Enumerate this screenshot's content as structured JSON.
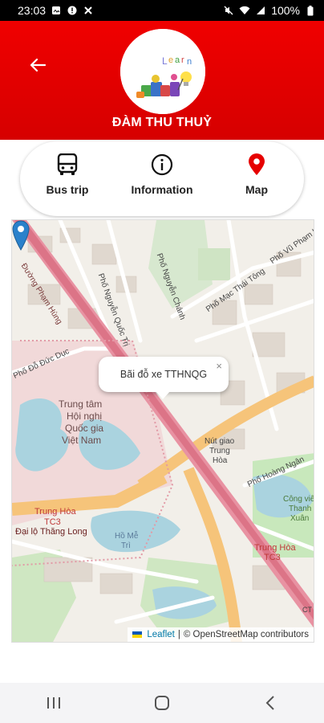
{
  "status_bar": {
    "time": "23:03",
    "battery": "100%",
    "left_icons": [
      "gallery-icon",
      "alert-icon",
      "tools-icon"
    ],
    "right_icons": [
      "mute-icon",
      "wifi-icon",
      "signal-icon",
      "battery-icon"
    ]
  },
  "header": {
    "school_name": "ĐÀM THU THUỶ",
    "background_color": "#e60000"
  },
  "tabs": [
    {
      "label": "Bus trip",
      "icon": "bus-icon",
      "color": "#111111"
    },
    {
      "label": "Information",
      "icon": "info-icon",
      "color": "#111111"
    },
    {
      "label": "Map",
      "icon": "map-pin-icon",
      "color": "#e60000"
    }
  ],
  "map": {
    "popup_text": "Bãi đỗ xe TTHNQG",
    "popup_close": "×",
    "labels": {
      "duong_pham_hung": "Đường Phạm Hùng",
      "pho_nguyen_chanh": "Phố Nguyễn Chánh",
      "pho_nguyen_quoc_tri": "Phố Nguyễn Quốc Trị",
      "pho_mac_thai_tong": "Phố Mạc Thái Tông",
      "pho_vu_pham_ham": "Phố Vũ Phạm Hàm",
      "pho_do_duc_duc": "Phố Đỗ Đức Dục",
      "trung_tam": "Trung tâm",
      "hoi_nghi": "Hội nghị",
      "quoc_gia": "Quốc gia",
      "viet_nam": "Việt Nam",
      "nut_giao": "Nút giao",
      "trung": "Trung",
      "hoa": "Hòa",
      "trung_hoa_tc3": "Trung Hòa",
      "dai_lo_thang_long": "Đại lộ Thăng Long",
      "ho_me_tri": "Hồ Mễ",
      "tri": "Trì",
      "pho_hoang_ngan": "Phố Hoàng Ngân",
      "cong_vien_thanh_xuan": "Công viên",
      "thanh": "Thanh",
      "xuan": "Xuân",
      "trung_hoa_tc3_b": "Trung Hòa",
      "tc3": "TC3",
      "tc3_b": "TC3",
      "ct_label": "CT"
    },
    "attribution": {
      "leaflet": "Leaflet",
      "separator": "|",
      "osm": "© OpenStreetMap contributors"
    }
  },
  "nav_bar": {
    "buttons": [
      "recent-apps-icon",
      "home-icon",
      "back-nav-icon"
    ]
  }
}
